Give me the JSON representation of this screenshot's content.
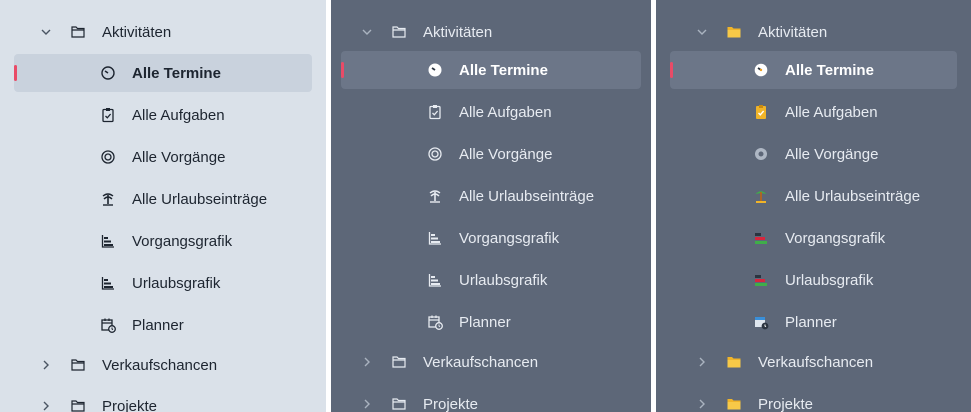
{
  "section_label": "Aktivitäten",
  "items": [
    {
      "label": "Alle Termine",
      "icon": "clock-icon"
    },
    {
      "label": "Alle Aufgaben",
      "icon": "task-icon"
    },
    {
      "label": "Alle Vorgänge",
      "icon": "target-icon"
    },
    {
      "label": "Alle Urlaubseinträge",
      "icon": "palm-tree-icon"
    },
    {
      "label": "Vorgangsgrafik",
      "icon": "gantt-chart-icon"
    },
    {
      "label": "Urlaubsgrafik",
      "icon": "gantt-chart-icon"
    },
    {
      "label": "Planner",
      "icon": "calendar-clock-icon"
    }
  ],
  "collapsed": [
    "Verkaufschancen",
    "Projekte"
  ],
  "accent": "#e94b67"
}
